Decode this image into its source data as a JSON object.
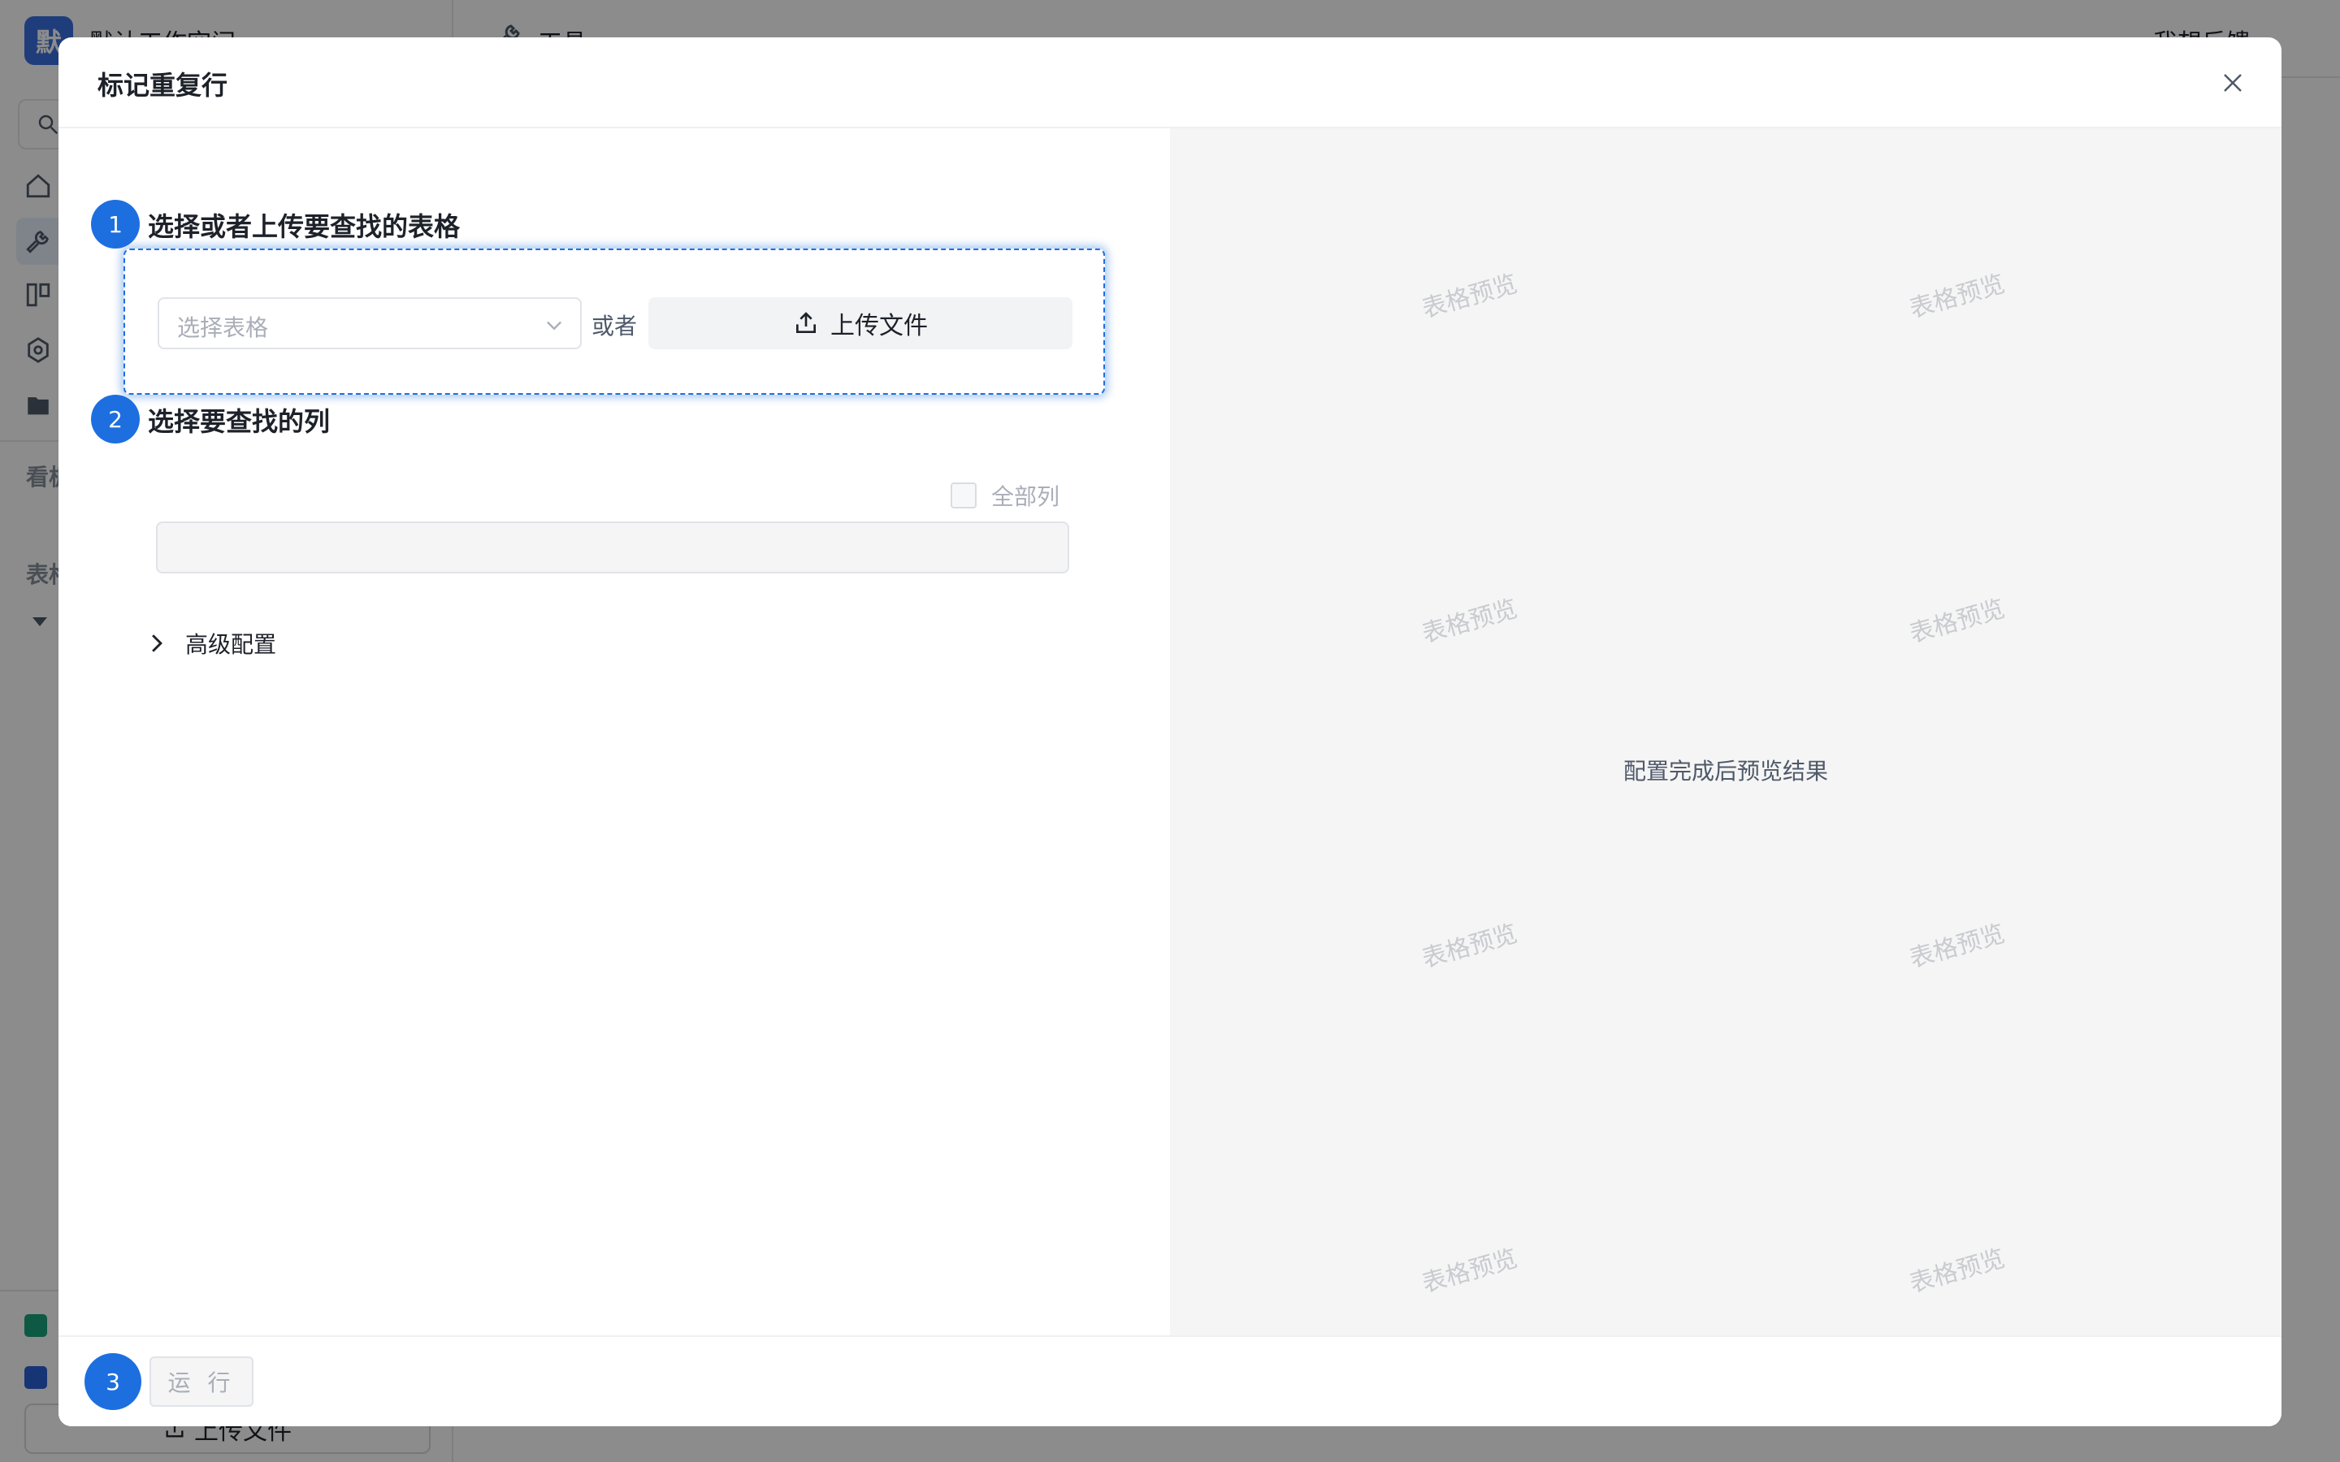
{
  "app": {
    "workspace_initial": "默",
    "workspace_name": "默认工作空间",
    "sidebar_sections": [
      "看板",
      "表格"
    ],
    "upload_label": "上传文件",
    "header_tool_label": "工具",
    "header_feedback": "我想反馈"
  },
  "modal": {
    "title": "标记重复行",
    "step1": {
      "number": "1",
      "title": "选择或者上传要查找的表格"
    },
    "table_select": {
      "placeholder": "选择表格"
    },
    "or_label": "或者",
    "upload_button": "上传文件",
    "step2": {
      "number": "2",
      "title": "选择要查找的列"
    },
    "all_columns_label": "全部列",
    "all_columns_checked": false,
    "advanced_label": "高级配置",
    "preview": {
      "watermark": "表格预览",
      "hint": "配置完成后预览结果"
    },
    "step3": {
      "number": "3"
    },
    "run_button": "运 行"
  },
  "colors": {
    "primary": "#1d6fe0",
    "overlay": "rgba(0,0,0,0.45)",
    "preview_bg": "#f5f5f5"
  }
}
